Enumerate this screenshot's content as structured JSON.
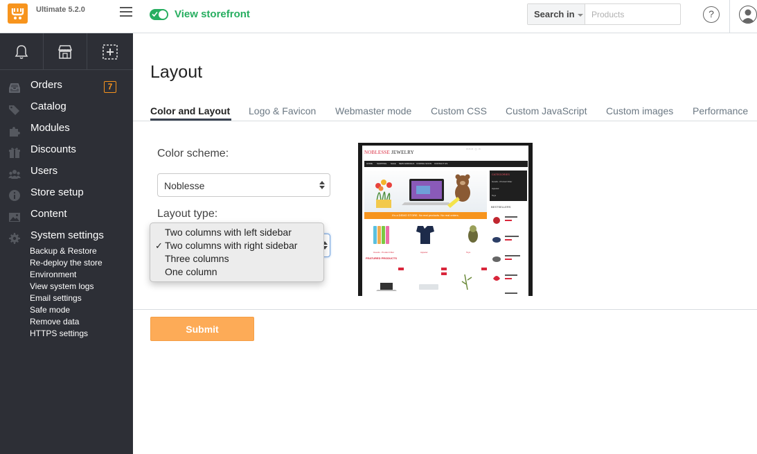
{
  "app": {
    "version": "Ultimate 5.2.0",
    "brand_color": "#f7941d"
  },
  "topbar": {
    "view_storefront_label": "View storefront",
    "search_scope_label": "Search in",
    "search_placeholder": "Products",
    "help_label": "?"
  },
  "sidebar": {
    "items": [
      {
        "label": "Orders",
        "icon": "inbox-icon",
        "badge": "7"
      },
      {
        "label": "Catalog",
        "icon": "tags-icon"
      },
      {
        "label": "Modules",
        "icon": "puzzle-icon"
      },
      {
        "label": "Discounts",
        "icon": "gift-icon"
      },
      {
        "label": "Users",
        "icon": "users-icon"
      },
      {
        "label": "Store setup",
        "icon": "info-icon"
      },
      {
        "label": "Content",
        "icon": "picture-icon"
      },
      {
        "label": "System settings",
        "icon": "gear-icon"
      }
    ],
    "system_settings_subitems": [
      "Backup & Restore",
      "Re-deploy the store",
      "Environment",
      "View system logs",
      "Email settings",
      "Safe mode",
      "Remove data",
      "HTTPS settings"
    ]
  },
  "main": {
    "title": "Layout",
    "tabs": [
      {
        "label": "Color and Layout",
        "active": true
      },
      {
        "label": "Logo & Favicon"
      },
      {
        "label": "Webmaster mode"
      },
      {
        "label": "Custom CSS"
      },
      {
        "label": "Custom JavaScript"
      },
      {
        "label": "Custom images"
      },
      {
        "label": "Performance"
      }
    ],
    "color_scheme_label": "Color scheme:",
    "color_scheme_value": "Noblesse",
    "layout_type_label": "Layout type:",
    "layout_options": [
      "Two columns with left sidebar",
      "Two columns with right sidebar",
      "Three columns",
      "One column"
    ],
    "layout_selected_check": "✓",
    "submit_label": "Submit"
  },
  "preview": {
    "brand_first": "NOBLESSE",
    "brand_second": " JEWELRY",
    "menu": [
      "HOME",
      "SHIPPING",
      "SALE",
      "NEW ARRIVALS",
      "COMING SOON",
      "CONTACT US"
    ],
    "banner_text": "It's a DEMO STORE. No real products. No real orders.",
    "sidebar_title": "CATEGORIES",
    "sidebar_links": [
      "Goods - Product Filter",
      "Apparel",
      "Toys"
    ],
    "bestsellers_title": "BESTSELLERS",
    "category_captions": [
      "iGoods - Product Filter",
      "Apparel",
      "Toys"
    ],
    "featured_title": "FEATURED PRODUCTS"
  }
}
